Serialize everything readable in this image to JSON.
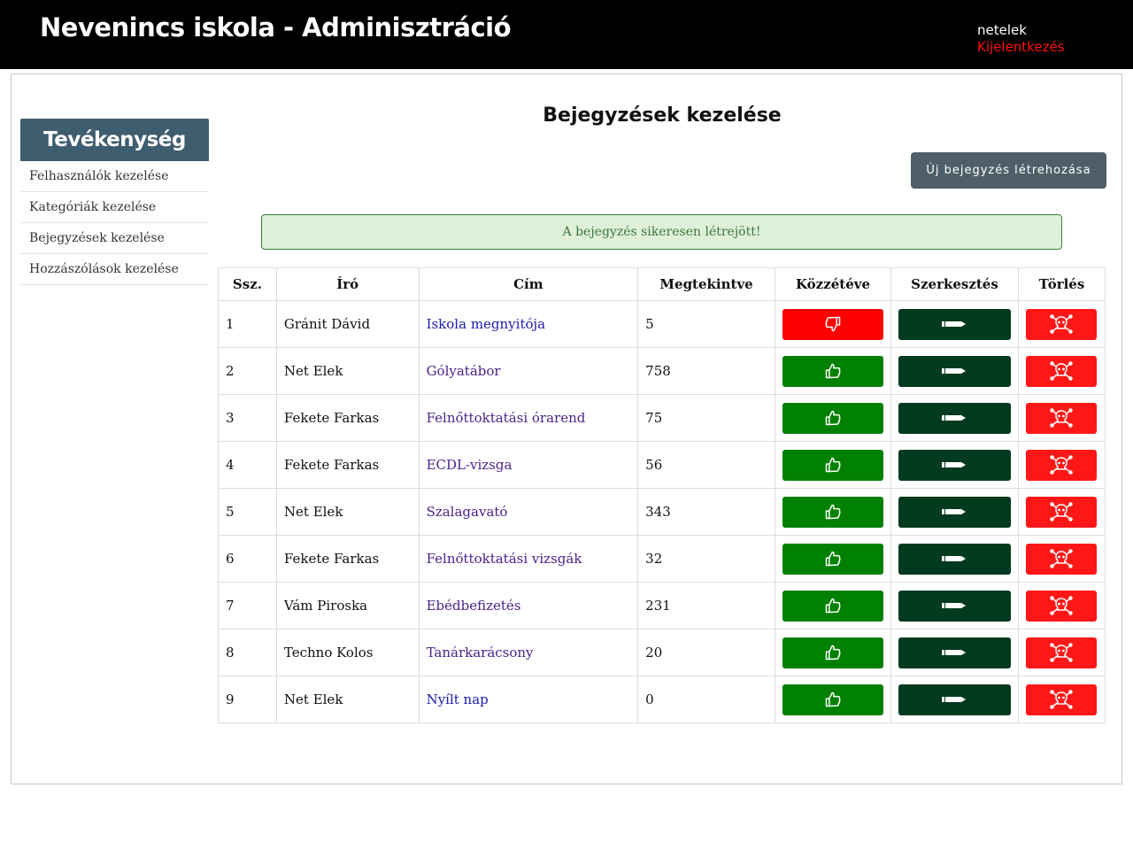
{
  "header": {
    "title": "Nevenincs iskola - Adminisztráció",
    "username": "netelek",
    "logout_label": "Kijelentkezés"
  },
  "sidebar": {
    "title": "Tevékenység",
    "items": [
      {
        "label": "Felhasználók kezelése"
      },
      {
        "label": "Kategóriák kezelése"
      },
      {
        "label": "Bejegyzések kezelése"
      },
      {
        "label": "Hozzászólások kezelése"
      }
    ]
  },
  "main": {
    "title": "Bejegyzések kezelése",
    "new_button_label": "Új bejegyzés létrehozása",
    "alert_text": "A bejegyzés sikeresen létrejött!"
  },
  "table": {
    "headers": {
      "num": "Ssz.",
      "author": "Író",
      "title": "Cím",
      "views": "Megtekintve",
      "published": "Közzétéve",
      "edit": "Szerkesztés",
      "delete": "Törlés"
    },
    "rows": [
      {
        "num": "1",
        "author": "Gránit Dávid",
        "title": "Iskola megnyitója",
        "views": "5",
        "published": false
      },
      {
        "num": "2",
        "author": "Net Elek",
        "title": "Gólyatábor",
        "views": "758",
        "published": true
      },
      {
        "num": "3",
        "author": "Fekete Farkas",
        "title": "Felnőttoktatási órarend",
        "views": "75",
        "published": true
      },
      {
        "num": "4",
        "author": "Fekete Farkas",
        "title": "ECDL-vizsga",
        "views": "56",
        "published": true
      },
      {
        "num": "5",
        "author": "Net Elek",
        "title": "Szalagavató",
        "views": "343",
        "published": true
      },
      {
        "num": "6",
        "author": "Fekete Farkas",
        "title": "Felnőttoktatási vizsgák",
        "views": "32",
        "published": true
      },
      {
        "num": "7",
        "author": "Vám Piroska",
        "title": "Ebédbefizetés",
        "views": "231",
        "published": true
      },
      {
        "num": "8",
        "author": "Techno Kolos",
        "title": "Tanárkarácsony",
        "views": "20",
        "published": true
      },
      {
        "num": "9",
        "author": "Net Elek",
        "title": "Nyílt nap",
        "views": "0",
        "published": true
      }
    ]
  },
  "colors": {
    "published_on": "#008000",
    "published_off": "#ff0000",
    "edit": "#003a1f",
    "delete": "#ff1717",
    "sidebar_header": "#3e5d6e"
  },
  "icons": {
    "published": "thumbs-up-icon",
    "unpublished": "thumbs-down-icon",
    "edit": "pencil-icon",
    "delete": "skull-crossbones-icon"
  }
}
